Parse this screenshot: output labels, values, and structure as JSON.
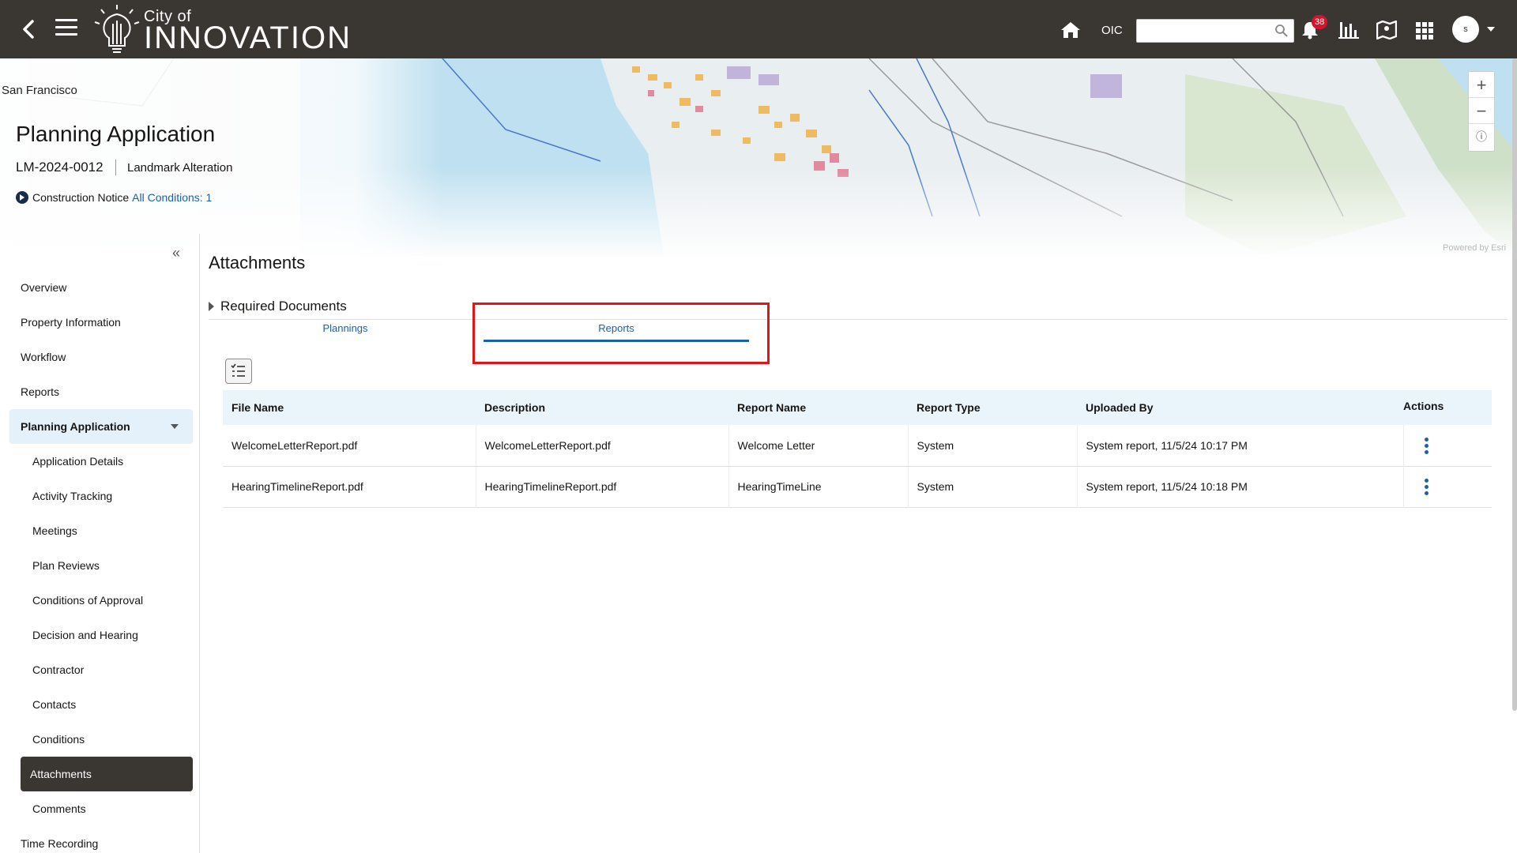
{
  "header": {
    "brand_small": "City of",
    "brand_big": "INNOVATION",
    "oic_label": "OIC",
    "search_value": "",
    "notification_count": "38",
    "avatar_initial": "s"
  },
  "map": {
    "place_label": "San Francisco",
    "attribution": "Powered by Esri"
  },
  "record": {
    "title": "Planning Application",
    "id": "LM-2024-0012",
    "type": "Landmark Alteration",
    "notice_label": "Construction Notice",
    "conditions_link": "All Conditions: 1"
  },
  "sidebar": {
    "items": [
      {
        "label": "Overview"
      },
      {
        "label": "Property Information"
      },
      {
        "label": "Workflow"
      },
      {
        "label": "Reports"
      }
    ],
    "group": {
      "label": "Planning Application"
    },
    "sub_items": [
      {
        "label": "Application Details"
      },
      {
        "label": "Activity Tracking"
      },
      {
        "label": "Meetings"
      },
      {
        "label": "Plan Reviews"
      },
      {
        "label": "Conditions of Approval"
      },
      {
        "label": "Decision and Hearing"
      },
      {
        "label": "Contractor"
      },
      {
        "label": "Contacts"
      },
      {
        "label": "Conditions"
      },
      {
        "label": "Attachments"
      },
      {
        "label": "Comments"
      }
    ],
    "bottom_item": {
      "label": "Time Recording"
    }
  },
  "main": {
    "title": "Attachments",
    "section": "Required Documents",
    "tabs": [
      {
        "label": "Plannings"
      },
      {
        "label": "Reports",
        "active": true
      }
    ],
    "table": {
      "columns": [
        "File Name",
        "Description",
        "Report Name",
        "Report Type",
        "Uploaded By",
        "Actions"
      ],
      "rows": [
        {
          "file": "WelcomeLetterReport.pdf",
          "desc": "WelcomeLetterReport.pdf",
          "report": "Welcome Letter",
          "type": "System",
          "uploaded": "System report, 11/5/24 10:17 PM"
        },
        {
          "file": "HearingTimelineReport.pdf",
          "desc": "HearingTimelineReport.pdf",
          "report": "HearingTimeLine",
          "type": "System",
          "uploaded": "System report, 11/5/24 10:18 PM"
        }
      ]
    }
  },
  "colors": {
    "topbar": "#3a3632",
    "link": "#1a61a6",
    "highlight": "#e0161a",
    "nav_group_bg": "#e4f0fa",
    "badge": "#d4142a"
  },
  "icons": [
    "back-arrow-icon",
    "hamburger-icon",
    "lightbulb-logo-icon",
    "home-icon",
    "search-icon",
    "bell-icon",
    "chart-icon",
    "map-icon",
    "app-grid-icon",
    "caret-down-icon",
    "zoom-in-icon",
    "zoom-out-icon",
    "info-icon",
    "double-chevron-left-icon",
    "triangle-right-icon",
    "list-settings-icon",
    "kebab-icon"
  ]
}
